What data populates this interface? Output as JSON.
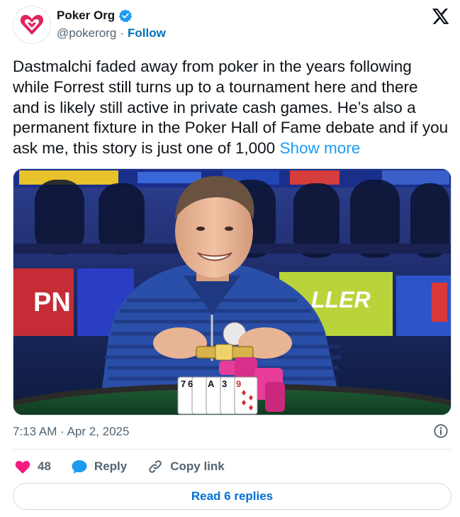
{
  "author": {
    "display_name": "Poker Org",
    "handle": "@pokerorg",
    "separator": "·",
    "follow_label": "Follow",
    "verified": true,
    "avatar_icon": "heart-logo-icon",
    "brand_color": "#e0245e"
  },
  "tweet": {
    "text": "Dastmalchi faded away from poker in the years following while Forrest still turns up to a tournament here and there and is likely still active in private cash games. He’s also a permanent fixture in the Poker Hall of Fame debate and if you ask me, this story is just one of 1,000",
    "show_more_label": "Show more"
  },
  "media": {
    "type": "photo",
    "banner_texts": [
      "PN",
      "LLER"
    ],
    "cards": [
      "7",
      "6",
      "A",
      "3",
      "9"
    ]
  },
  "meta": {
    "timestamp": "7:13 AM · Apr 2, 2025"
  },
  "actions": {
    "like_count": "48",
    "reply_label": "Reply",
    "copy_link_label": "Copy link"
  },
  "footer": {
    "read_replies_label": "Read 6 replies"
  },
  "colors": {
    "like": "#f91880",
    "reply": "#1d9bf0",
    "link": "#1d9bf0",
    "follow": "#0072b8",
    "secondary_text": "#536471"
  }
}
